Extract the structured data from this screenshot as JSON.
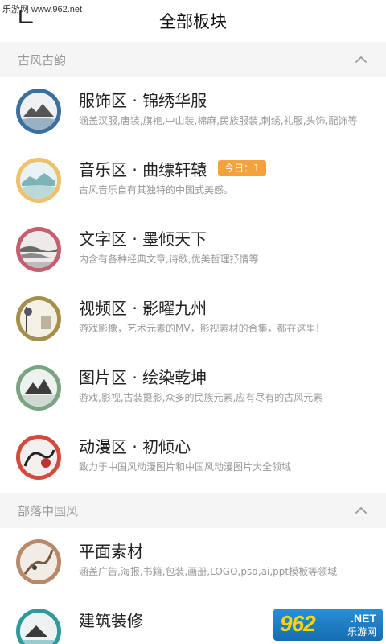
{
  "watermark": "乐游网 www.962.net",
  "header": {
    "title": "全部板块"
  },
  "sections": [
    {
      "label": "古风古韵",
      "items": [
        {
          "title": "服饰区 · 锦绣华服",
          "desc": "涵盖汉服,唐装,旗袍,中山装,棉麻,民族服装,刺绣,礼服,头饰,配饰等",
          "ring": "#3b6f9e",
          "badge": ""
        },
        {
          "title": "音乐区 · 曲缥轩辕",
          "desc": "古风音乐自有其独特的中国式美感。",
          "ring": "#eec06a",
          "badge": "今日：1"
        },
        {
          "title": "文字区 · 墨倾天下",
          "desc": "内含有各种经典文章,诗歌,优美哲理抒情等",
          "ring": "#c4606e",
          "badge": ""
        },
        {
          "title": "视频区 · 影曜九州",
          "desc": "游戏影像，艺术元素的MV，影视素材的合集，都在这里!",
          "ring": "#a4904a",
          "badge": ""
        },
        {
          "title": "图片区 · 绘染乾坤",
          "desc": "游戏,影视,古装摄影,众多的民族元素,应有尽有的古风元素",
          "ring": "#7aa382",
          "badge": ""
        },
        {
          "title": "动漫区 · 初倾心",
          "desc": "致力于中国风动漫图片和中国风动漫图片大全领域",
          "ring": "#d24b3c",
          "badge": ""
        }
      ]
    },
    {
      "label": "部落中国风",
      "items": [
        {
          "title": "平面素材",
          "desc": "涵盖广告,海报,书籍,包装,画册,LOGO,psd,ai,ppt模板等领域",
          "ring": "#b98a6a",
          "badge": ""
        },
        {
          "title": "建筑装修",
          "desc": "",
          "ring": "#2e9a9c",
          "badge": ""
        }
      ]
    }
  ],
  "logo": {
    "num": "962",
    "net": ".NET",
    "cn": "乐游网"
  }
}
